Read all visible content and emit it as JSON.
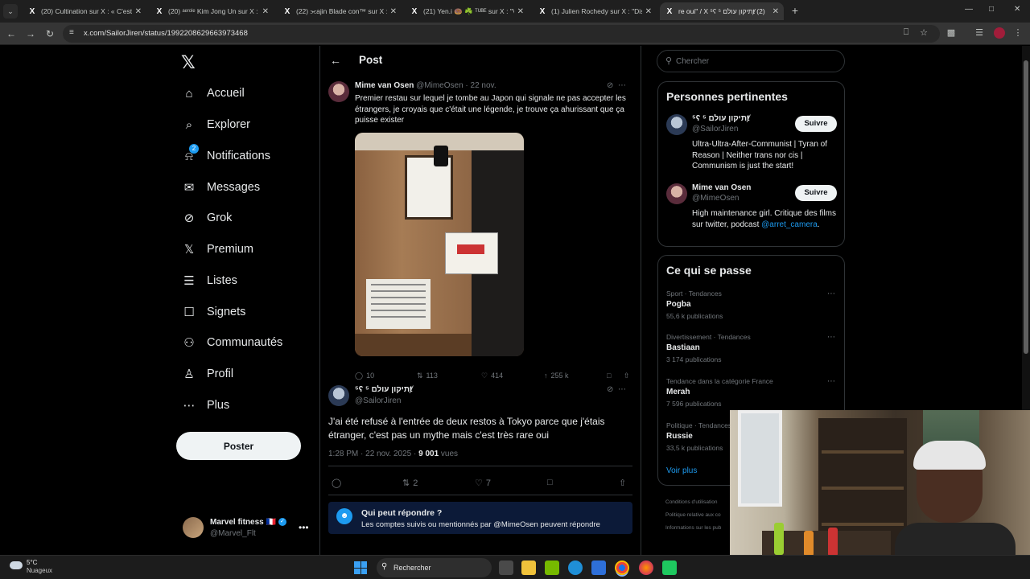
{
  "browser": {
    "tabs": [
      {
        "title": "(20) Cultination sur X : « C'est l"
      },
      {
        "title": "(20) ᵃᵉʳᵒˡᵉ Kim Jong Un sur X : \"I"
      },
      {
        "title": "(22) ⫘ajin Blade con™ sur X :"
      },
      {
        "title": "(21) Yen.i 🍩 ☘️ ᵀᵁᴮᴱ sur X : \"Vu"
      },
      {
        "title": "(1) Julien Rochedy sur X : \"Discu"
      },
      {
        "title": "re oui\" / X ⁵ʕ תיקון עולם ⁵ⱦ (2)"
      }
    ],
    "new_tab": "+",
    "url": "x.com/SailorJiren/status/1992208629663973468",
    "window_controls": [
      "—",
      "□",
      "✕"
    ]
  },
  "nav": {
    "logo": "𝕏",
    "items": [
      {
        "label": "Accueil",
        "icon": "home-icon",
        "glyph": "⌂"
      },
      {
        "label": "Explorer",
        "icon": "search-icon",
        "glyph": "⌕"
      },
      {
        "label": "Notifications",
        "icon": "bell-icon",
        "glyph": "⍾",
        "badge": "2"
      },
      {
        "label": "Messages",
        "icon": "envelope-icon",
        "glyph": "✉"
      },
      {
        "label": "Grok",
        "icon": "grok-icon",
        "glyph": "⊘"
      },
      {
        "label": "Premium",
        "icon": "x-premium-icon",
        "glyph": "𝕏"
      },
      {
        "label": "Listes",
        "icon": "list-icon",
        "glyph": "☰"
      },
      {
        "label": "Signets",
        "icon": "bookmark-icon",
        "glyph": "☐"
      },
      {
        "label": "Communautés",
        "icon": "communities-icon",
        "glyph": "⚇"
      },
      {
        "label": "Profil",
        "icon": "profile-icon",
        "glyph": "♙"
      },
      {
        "label": "Plus",
        "icon": "more-circle-icon",
        "glyph": "⋯"
      }
    ],
    "post_button": "Poster",
    "account": {
      "name": "Marvel fitness 🇫🇷",
      "handle": "@Marvel_Flt",
      "more": "•••"
    }
  },
  "main": {
    "header_title": "Post",
    "quoted_post": {
      "name": "Mime van Osen",
      "handle": "@MimeOsen",
      "date": "· 22 nov.",
      "text": "Premier restau sur lequel je tombe au Japon qui signale ne pas accepter les étrangers, je croyais que c'était une légende, je trouve ça ahurissant que ça puisse exister",
      "stats": {
        "replies": "10",
        "reposts": "113",
        "likes": "414",
        "views": "255 k"
      }
    },
    "reply": {
      "name": "⁵ʕ תיקון עולם ⁵ⱦ",
      "handle": "@SailorJiren",
      "text": "J'ai été refusé à l'entrée de deux restos à Tokyo parce que j'étais étranger, c'est pas un mythe mais c'est très rare oui",
      "time": "1:28 PM · 22 nov. 2025 · ",
      "views_count": "9 001",
      "views_label": " vues",
      "stats": {
        "replies": "",
        "reposts": "2",
        "likes": "7"
      }
    },
    "who_can_reply": {
      "title": "Qui peut répondre ?",
      "text": "Les comptes suivis ou mentionnés par @MimeOsen peuvent répondre"
    }
  },
  "right": {
    "search_placeholder": "Chercher",
    "relevant": {
      "title": "Personnes pertinentes",
      "people": [
        {
          "name": "⁵ʕ תיקון עולם ⁵ⱦ",
          "handle": "@SailorJiren",
          "bio": "Ultra-Ultra-After-Communist | Tyran of Reason | Neither trans nor cis | Communism is just the start!",
          "bio_link": "",
          "button": "Suivre"
        },
        {
          "name": "Mime van Osen",
          "handle": "@MimeOsen",
          "bio": "High maintenance girl. Critique des films sur twitter, podcast ",
          "bio_link": "@arret_camera",
          "bio_end": ".",
          "button": "Suivre"
        }
      ]
    },
    "trends": {
      "title": "Ce qui se passe",
      "items": [
        {
          "category": "Sport · Tendances",
          "name": "Pogba",
          "count": "55,6 k publications"
        },
        {
          "category": "Divertissement · Tendances",
          "name": "Bastiaan",
          "count": "3 174 publications"
        },
        {
          "category": "Tendance dans la catégorie France",
          "name": "Merah",
          "count": "7 596 publications"
        },
        {
          "category": "Politique · Tendances",
          "name": "Russie",
          "count": "33,5 k publications"
        }
      ],
      "see_more": "Voir plus"
    },
    "footer_links": [
      "Conditions d'utilisation",
      "Politique relative aux co",
      "Informations sur les pub"
    ]
  },
  "taskbar": {
    "temperature": "5°C",
    "weather": "Nuageux",
    "search_placeholder": "Rechercher"
  }
}
